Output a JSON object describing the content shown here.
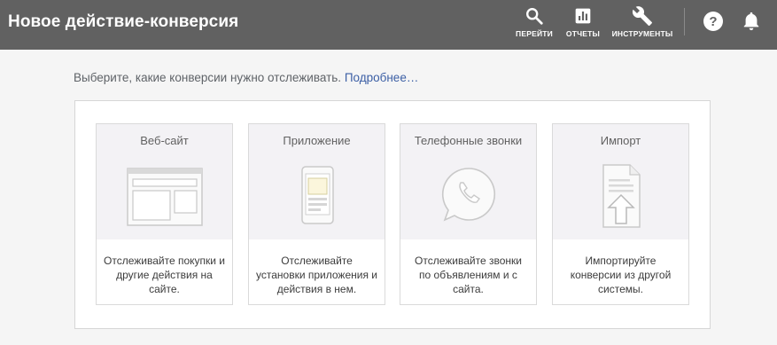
{
  "header": {
    "title": "Новое действие-конверсия",
    "nav": [
      {
        "label": "ПЕРЕЙТИ",
        "icon": "search-icon"
      },
      {
        "label": "ОТЧЕТЫ",
        "icon": "reports-icon"
      },
      {
        "label": "ИНСТРУМЕНТЫ",
        "icon": "wrench-icon"
      }
    ],
    "help_icon": "help-icon",
    "bell_icon": "bell-icon"
  },
  "intro": {
    "text": "Выберите, какие конверсии нужно отслеживать.",
    "link": "Подробнее…"
  },
  "cards": [
    {
      "title": "Веб-сайт",
      "icon": "website-icon",
      "desc": "Отслеживайте покупки и другие действия на сайте."
    },
    {
      "title": "Приложение",
      "icon": "app-icon",
      "desc": "Отслеживайте установки приложения и действия в нем."
    },
    {
      "title": "Телефонные звонки",
      "icon": "phone-icon",
      "desc": "Отслеживайте звонки по объявлениям и с сайта."
    },
    {
      "title": "Импорт",
      "icon": "import-icon",
      "desc": "Импортируйте конверсии из другой системы."
    }
  ],
  "colors": {
    "topbar": "#616161",
    "link": "#3c5fa5",
    "card_top": "#f3f2f5"
  }
}
